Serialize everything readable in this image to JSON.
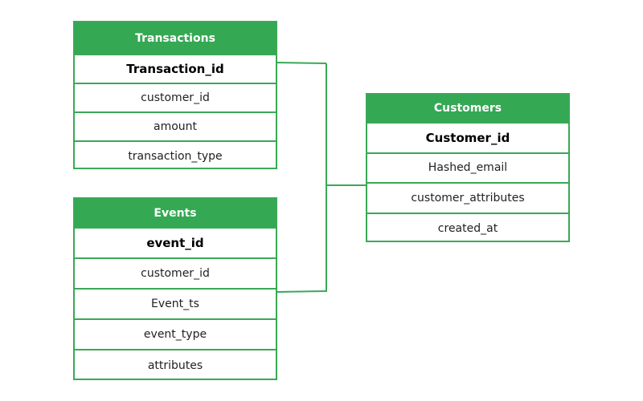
{
  "diagram": {
    "colors": {
      "header_bg": "#34a853",
      "border": "#3aa856",
      "header_text": "#ffffff"
    },
    "tables": {
      "transactions": {
        "title": "Transactions",
        "fields": [
          "Transaction_id",
          "customer_id",
          "amount",
          "transaction_type"
        ],
        "primary_key": "Transaction_id"
      },
      "events": {
        "title": "Events",
        "fields": [
          "event_id",
          "customer_id",
          "Event_ts",
          "event_type",
          "attributes"
        ],
        "primary_key": "event_id"
      },
      "customers": {
        "title": "Customers",
        "fields": [
          "Customer_id",
          "Hashed_email",
          "customer_attributes",
          "created_at"
        ],
        "primary_key": "Customer_id"
      }
    },
    "relationships": [
      {
        "from": "transactions.Transaction_id",
        "to": "customers.customer_attributes"
      },
      {
        "from": "events.Event_ts",
        "to": "customers.customer_attributes"
      }
    ]
  }
}
